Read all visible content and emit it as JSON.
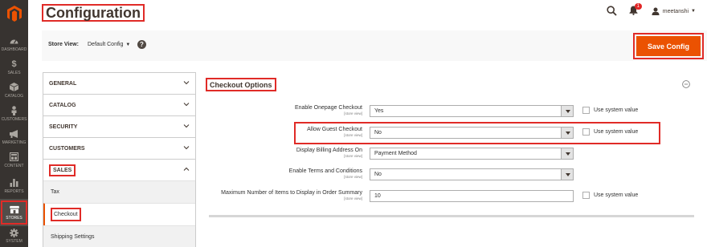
{
  "sidebar": {
    "items": [
      {
        "label": "DASHBOARD",
        "icon": "dashboard-icon"
      },
      {
        "label": "SALES",
        "icon": "dollar-icon"
      },
      {
        "label": "CATALOG",
        "icon": "cube-icon"
      },
      {
        "label": "CUSTOMERS",
        "icon": "person-icon"
      },
      {
        "label": "MARKETING",
        "icon": "megaphone-icon"
      },
      {
        "label": "CONTENT",
        "icon": "layout-icon"
      },
      {
        "label": "REPORTS",
        "icon": "bar-chart-icon"
      },
      {
        "label": "STORES",
        "icon": "store-icon"
      },
      {
        "label": "SYSTEM",
        "icon": "gear-icon"
      }
    ],
    "active": "STORES"
  },
  "header": {
    "title": "Configuration",
    "notifications_count": "1",
    "username": "meetanshi"
  },
  "store_view": {
    "label": "Store View:",
    "value": "Default Config",
    "help": "?"
  },
  "toolbar": {
    "save_label": "Save Config"
  },
  "config_nav": {
    "tabs": [
      "GENERAL",
      "CATALOG",
      "SECURITY",
      "CUSTOMERS",
      "SALES"
    ],
    "sub_items": [
      "Tax",
      "Checkout",
      "Shipping Settings"
    ],
    "active_sub": "Checkout"
  },
  "section": {
    "title": "Checkout Options",
    "fields": [
      {
        "label": "Enable Onepage Checkout",
        "scope": "[store view]",
        "value": "Yes",
        "system_value_label": "Use system value"
      },
      {
        "label": "Allow Guest Checkout",
        "scope": "[store view]",
        "value": "No",
        "system_value_label": "Use system value"
      },
      {
        "label": "Display Billing Address On",
        "scope": "[store view]",
        "value": "Payment Method"
      },
      {
        "label": "Enable Terms and Conditions",
        "scope": "[store view]",
        "value": "No"
      },
      {
        "label": "Maximum Number of Items to Display in Order Summary",
        "scope": "[store view]",
        "value": "10",
        "system_value_label": "Use system value"
      }
    ]
  },
  "colors": {
    "sidebar_bg": "#373330",
    "accent": "#eb5202",
    "highlight": "#e02b27"
  }
}
